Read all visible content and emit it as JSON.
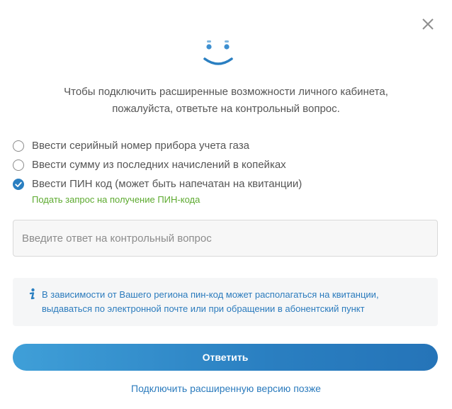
{
  "dialog": {
    "intro_line1": "Чтобы подключить расширенные возможности личного кабинета,",
    "intro_line2": "пожалуйста, ответьте на контрольный вопрос.",
    "options": [
      {
        "label": "Ввести серийный номер прибора учета газа",
        "checked": false
      },
      {
        "label": "Ввести сумму из последних начислений в копейках",
        "checked": false
      },
      {
        "label": "Ввести ПИН код (может быть напечатан на квитанции)",
        "checked": true
      }
    ],
    "pin_request_link": "Подать запрос на получение ПИН-кода",
    "answer_placeholder": "Введите ответ на контрольный вопрос",
    "answer_value": "",
    "info_line1": "В зависимости от Вашего региона пин-код может располагаться на квитанции,",
    "info_line2": "выдаваться по электронной почте или при обращении в абонентский пункт",
    "submit_label": "Ответить",
    "later_link": "Подключить расширенную версию позже"
  },
  "icons": {
    "close": "close-icon",
    "smiley": "smiley-icon",
    "info": "info-icon",
    "check": "check-icon"
  },
  "colors": {
    "accent": "#2a7fc1",
    "link_green": "#5daa2f",
    "link_blue": "#2b7bbd",
    "text": "#555555"
  }
}
